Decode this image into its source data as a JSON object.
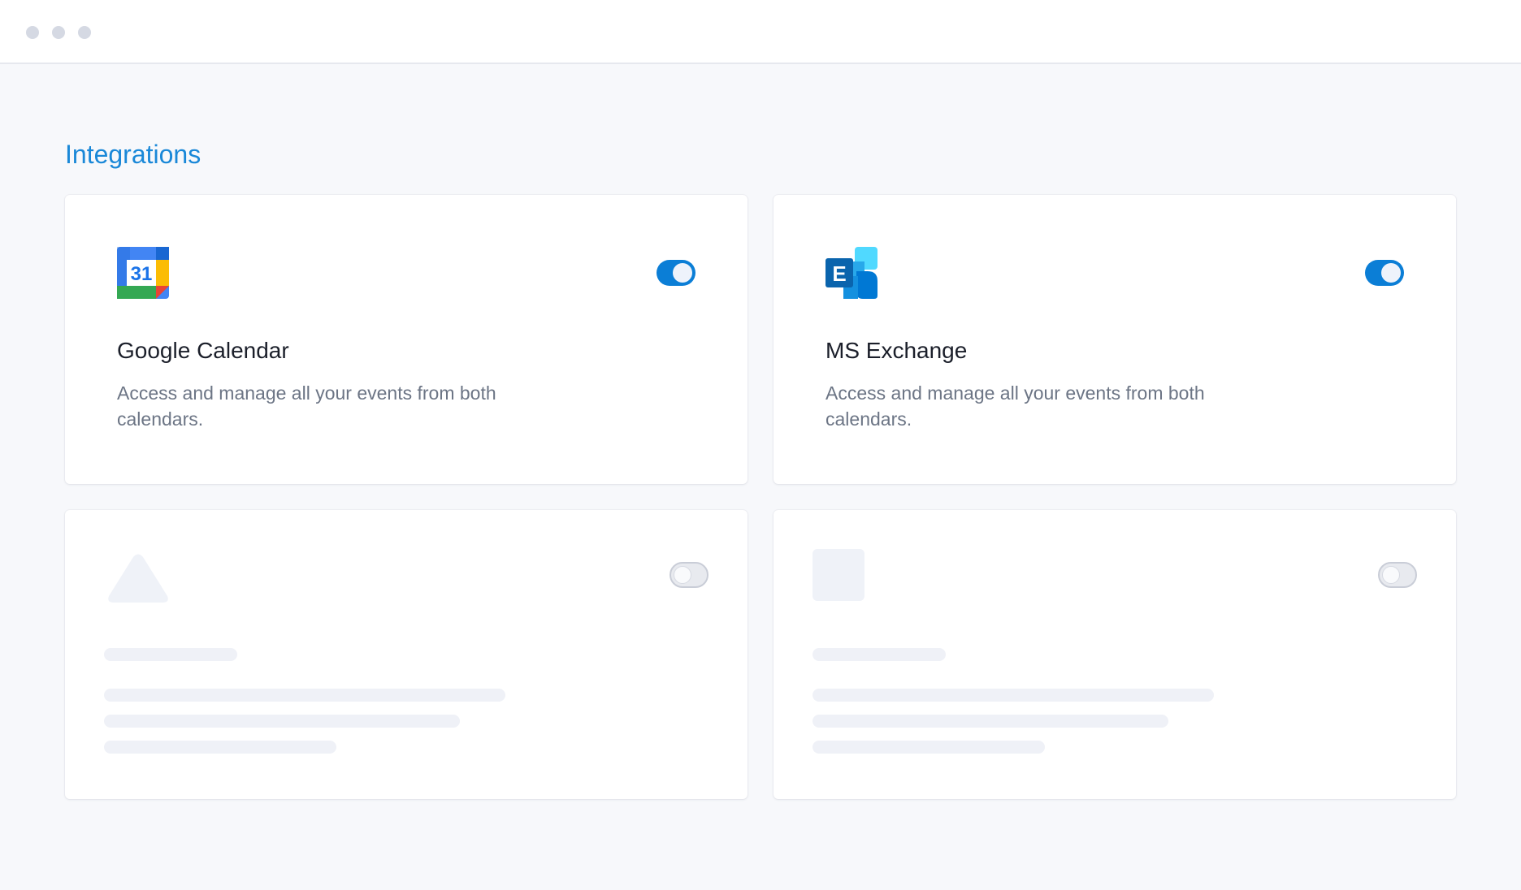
{
  "page": {
    "section_title": "Integrations"
  },
  "integrations": [
    {
      "name": "Google Calendar",
      "description": "Access and manage all your events from both calendars.",
      "enabled": true,
      "icon": "google-calendar-icon",
      "icon_text": "31"
    },
    {
      "name": "MS Exchange",
      "description": "Access and manage all your events from both calendars.",
      "enabled": true,
      "icon": "ms-exchange-icon",
      "icon_text": "E"
    }
  ],
  "placeholders": [
    {
      "enabled": false,
      "icon": "triangle-placeholder-icon"
    },
    {
      "enabled": false,
      "icon": "square-placeholder-icon"
    }
  ],
  "colors": {
    "accent": "#1a88d8",
    "toggle_on": "#0b7ed6",
    "background": "#f7f8fb"
  }
}
